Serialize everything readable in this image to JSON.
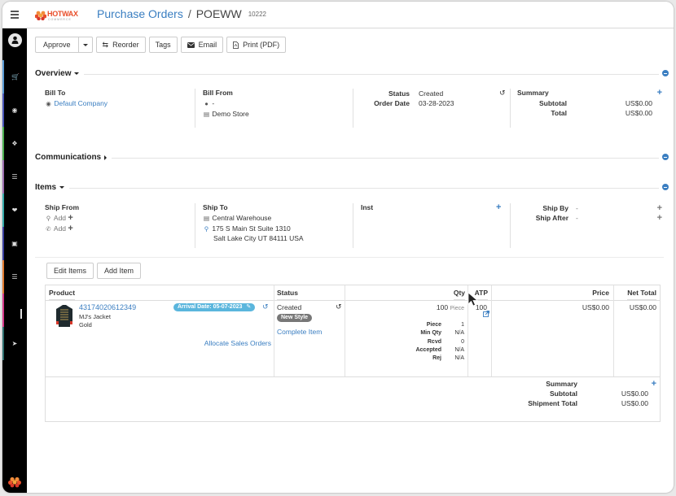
{
  "header": {
    "logo_text": "HOTWAX",
    "logo_subtext": "COMMERCE",
    "breadcrumb_parent": "Purchase Orders",
    "breadcrumb_separator": "/",
    "order_name": "POEWW",
    "order_id": "10222"
  },
  "sidebar": {
    "items": [
      {
        "icon": "cart-icon",
        "color": "#5b9bd5"
      },
      {
        "icon": "users-icon",
        "color": "#4a56b8"
      },
      {
        "icon": "cubes-icon",
        "color": "#4caf50"
      },
      {
        "icon": "list-icon",
        "color": "#9c6fb0"
      },
      {
        "icon": "dropbox-icon",
        "color": "#35a9a9"
      },
      {
        "icon": "money-icon",
        "color": "#3a3f9e"
      },
      {
        "icon": "database-icon",
        "color": "#e07a2f"
      },
      {
        "icon": "blank-icon",
        "color": "#d63a8a"
      },
      {
        "icon": "sign-out-icon",
        "color": "#2e6e6e"
      }
    ]
  },
  "toolbar": {
    "approve_label": "Approve",
    "reorder_label": "Reorder",
    "tags_label": "Tags",
    "email_label": "Email",
    "print_label": "Print (PDF)"
  },
  "overview": {
    "title": "Overview",
    "bill_to_label": "Bill To",
    "bill_to_value": "Default Company",
    "bill_from_label": "Bill From",
    "bill_from_person": "-",
    "bill_from_store": "Demo Store",
    "status_label": "Status",
    "status_value": "Created",
    "order_date_label": "Order Date",
    "order_date_value": "03-28-2023",
    "summary_label": "Summary",
    "subtotal_label": "Subtotal",
    "subtotal_value": "US$0.00",
    "total_label": "Total",
    "total_value": "US$0.00"
  },
  "communications": {
    "title": "Communications"
  },
  "items_section": {
    "title": "Items",
    "ship_from_label": "Ship From",
    "ship_from_address_add": "Add",
    "ship_from_phone_add": "Add",
    "ship_to_label": "Ship To",
    "ship_to_facility": "Central Warehouse",
    "ship_to_address1": "175 S Main St Suite 1310",
    "ship_to_address2": "Salt Lake City UT 84111 USA",
    "inst_label": "Inst",
    "ship_by_label": "Ship By",
    "ship_by_value": "-",
    "ship_after_label": "Ship After",
    "ship_after_value": "-",
    "edit_items_label": "Edit Items",
    "add_item_label": "Add Item"
  },
  "items_table": {
    "columns": [
      "Product",
      "Status",
      "Qty",
      "ATP",
      "Price",
      "Net Total"
    ],
    "rows": [
      {
        "product_id": "43174020612349",
        "product_name": "MJ's Jacket",
        "product_variant": "Gold",
        "arrival_date": "Arrival Date: 05-07-2023",
        "allocate_link": "Allocate Sales Orders",
        "status": "Created",
        "style_badge": "New Style",
        "complete_link": "Complete Item",
        "qty": "100",
        "qty_unit": "Piece",
        "qty_details": [
          {
            "label": "Piece",
            "value": "1"
          },
          {
            "label": "Min Qty",
            "value": "N/A"
          },
          {
            "label": "Rcvd",
            "value": "0"
          },
          {
            "label": "Accepted",
            "value": "N/A"
          },
          {
            "label": "Rej",
            "value": "N/A"
          }
        ],
        "atp": "100",
        "price": "US$0.00",
        "net_total": "US$0.00"
      }
    ],
    "summary_label": "Summary",
    "subtotal_label": "Subtotal",
    "subtotal_value": "US$0.00",
    "shipment_total_label": "Shipment Total",
    "shipment_total_value": "US$0.00"
  },
  "colors": {
    "accent": "#3a7ec1",
    "arrival_badge": "#5bb6dd",
    "style_badge": "#777777",
    "brand": "#e94e2a"
  }
}
